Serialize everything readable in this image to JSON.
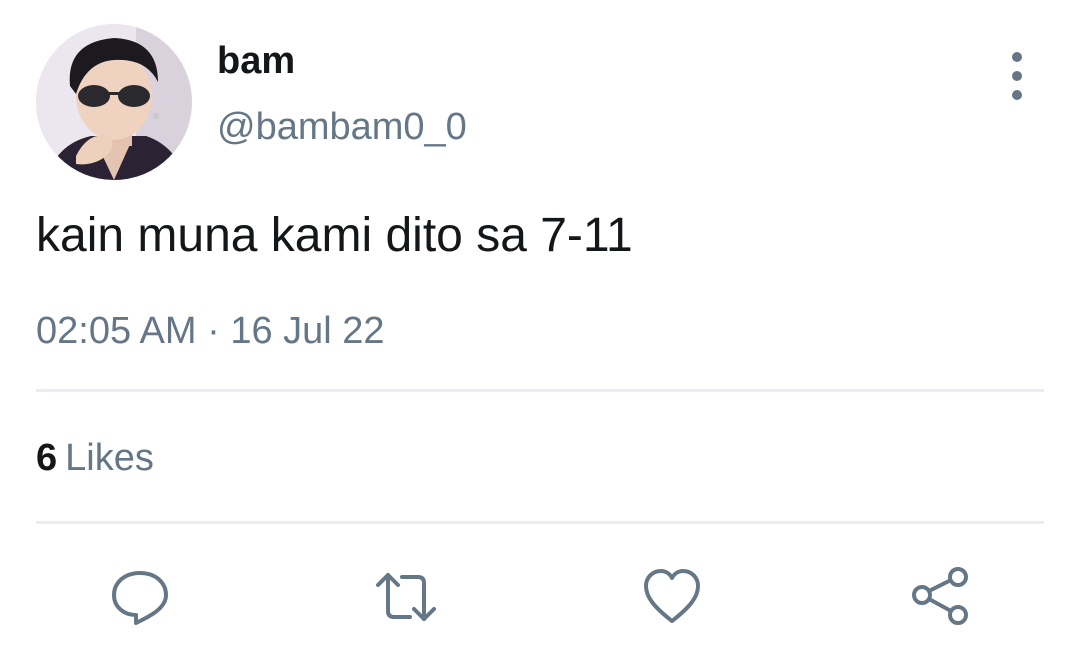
{
  "tweet": {
    "display_name": "bam",
    "handle": "@bambam0_0",
    "text": "kain muna kami dito sa 7-11",
    "time": "02:05 AM",
    "separator": "·",
    "date": "16 Jul 22"
  },
  "stats": {
    "likes_count": "6",
    "likes_label": "Likes"
  },
  "actions": {
    "icons": [
      "reply-icon",
      "retweet-icon",
      "like-icon",
      "share-icon"
    ]
  },
  "menu": {
    "icon": "more-vertical-icon"
  },
  "colors": {
    "text_primary": "#14171a",
    "text_secondary": "#657786",
    "divider": "#e6ecf0",
    "background": "#ffffff"
  }
}
